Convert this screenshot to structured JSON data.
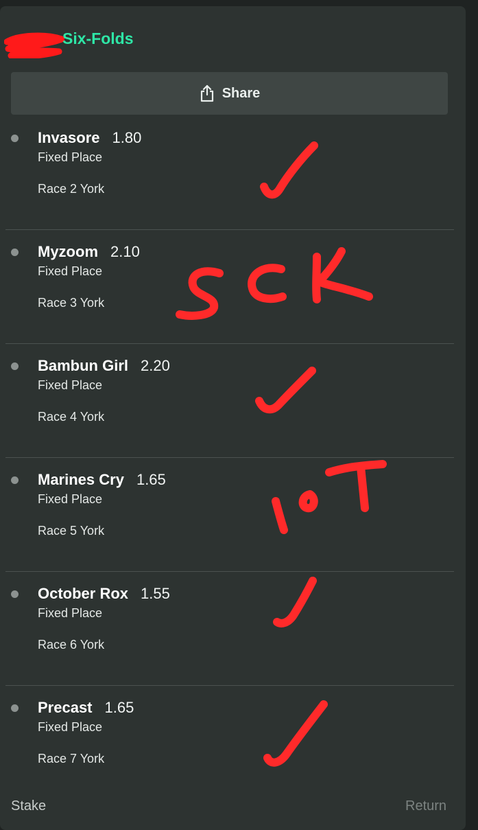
{
  "bet": {
    "title": "Six-Folds",
    "share_label": "Share",
    "legs": [
      {
        "name": "Invasore",
        "odds": "1.80",
        "market": "Fixed Place",
        "race": "Race 2 York"
      },
      {
        "name": "Myzoom",
        "odds": "2.10",
        "market": "Fixed Place",
        "race": "Race 3 York"
      },
      {
        "name": "Bambun Girl",
        "odds": "2.20",
        "market": "Fixed Place",
        "race": "Race 4 York"
      },
      {
        "name": "Marines Cry",
        "odds": "1.65",
        "market": "Fixed Place",
        "race": "Race 5 York"
      },
      {
        "name": "October Rox",
        "odds": "1.55",
        "market": "Fixed Place",
        "race": "Race 6 York"
      },
      {
        "name": "Precast",
        "odds": "1.65",
        "market": "Fixed Place",
        "race": "Race 7 York"
      }
    ],
    "footer": {
      "stake_label": "Stake",
      "return_label": "Return"
    }
  },
  "colors": {
    "accent": "#2ee6a6",
    "annotation": "#ff2a2a",
    "card": "#2d3331"
  }
}
